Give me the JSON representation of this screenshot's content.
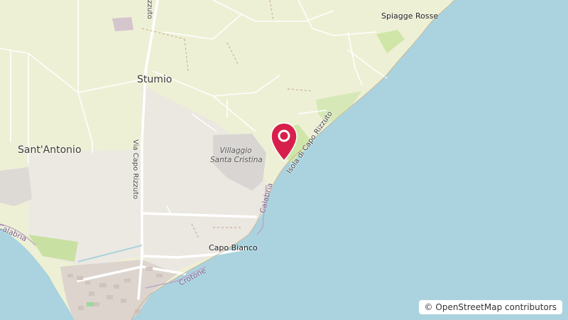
{
  "map": {
    "labels": {
      "stumio": "Stumio",
      "sant_antonio": "Sant'Antonio",
      "spiagge_rosse": "Spiagge Rosse",
      "villaggio_line1": "Villaggio",
      "villaggio_line2": "Santa Cristina",
      "capo_bianco": "Capo Bianco",
      "via_capo_rizzuto": "Via Capo Rizzuto",
      "road_top": "zzuto",
      "isola": "Isola di Capo Rizzuto",
      "calabria_coast": "Calabria",
      "calabria_west": "Calabria",
      "crotone": "Crotone"
    },
    "marker_icon": "location-pin-icon",
    "marker_color": "#d6204b",
    "colors": {
      "sea": "#aad3df",
      "farmland": "#eef0d5",
      "residential": "#e8e4de",
      "park": "#c8df9e",
      "built": "#d9d0c9"
    }
  },
  "attribution": {
    "symbol": "©",
    "text": "OpenStreetMap contributors"
  }
}
